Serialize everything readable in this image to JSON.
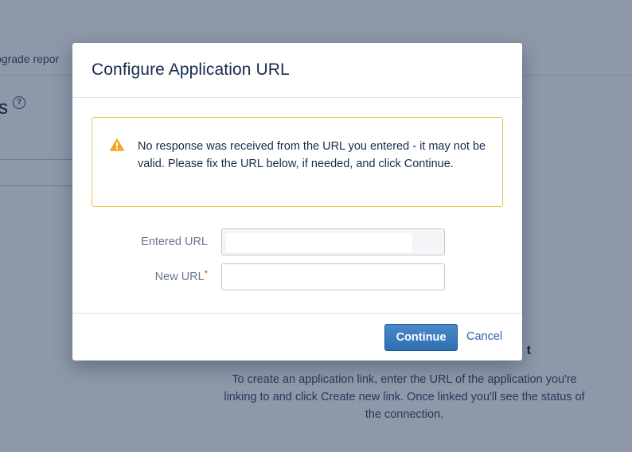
{
  "background": {
    "breadcrumb": "pgrade repor",
    "heading": "s",
    "empty_state_title": "t",
    "empty_state_description": "To create an application link, enter the URL of the application you're linking to and click Create new link. Once linked you'll see the status of the connection."
  },
  "dialog": {
    "title": "Configure Application URL",
    "warning": {
      "icon": "warning-triangle",
      "color": "#f5a623",
      "message": "No response was received from the URL you entered - it may not be valid. Please fix the URL below, if needed, and click Continue."
    },
    "fields": {
      "entered_url_label": "Entered URL",
      "entered_url_value": "",
      "new_url_label": "New URL",
      "new_url_required_mark": "*",
      "new_url_value": ""
    },
    "footer": {
      "continue_label": "Continue",
      "cancel_label": "Cancel"
    }
  }
}
